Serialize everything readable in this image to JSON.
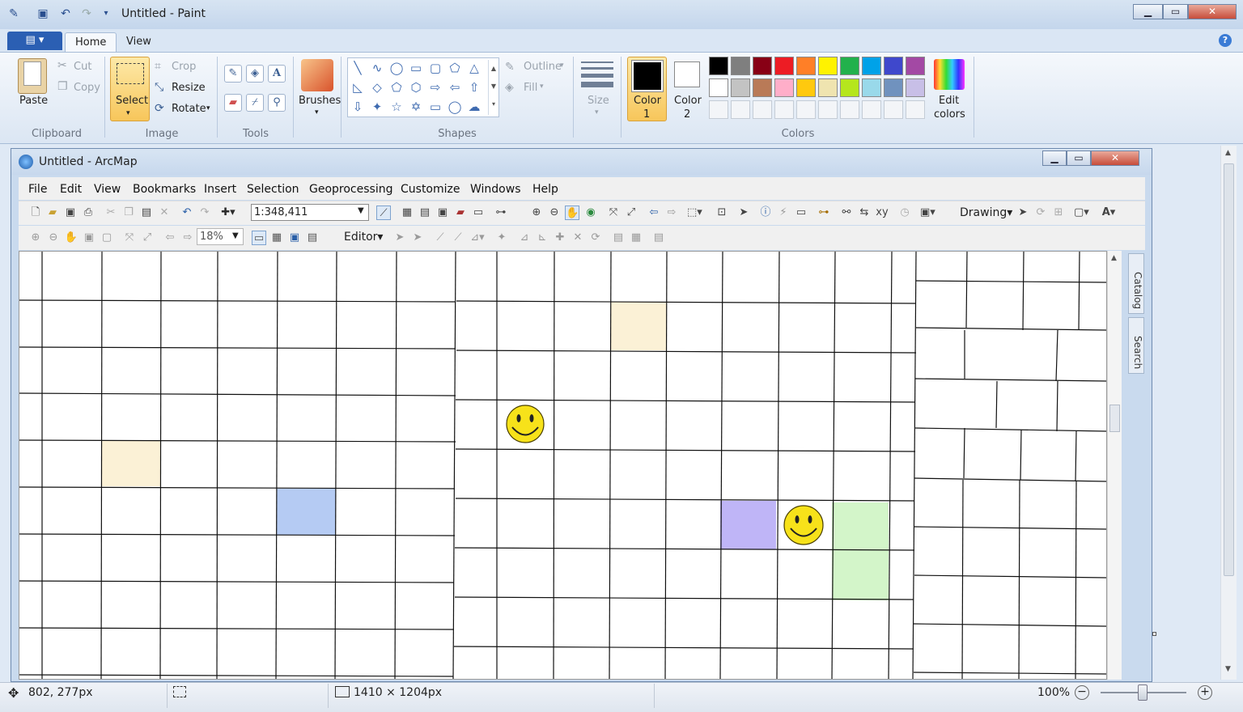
{
  "paint": {
    "title": "Untitled - Paint",
    "tabs": {
      "file_menu": "▤ ▾",
      "home": "Home",
      "view": "View"
    },
    "help": "?",
    "clipboard": {
      "paste": "Paste",
      "cut": "Cut",
      "copy": "Copy",
      "group": "Clipboard"
    },
    "image": {
      "select": "Select",
      "crop": "Crop",
      "resize": "Resize",
      "rotate": "Rotate",
      "group": "Image"
    },
    "tools": {
      "group": "Tools"
    },
    "brushes": {
      "label": "Brushes"
    },
    "shapes": {
      "outline": "Outline",
      "fill": "Fill",
      "group": "Shapes"
    },
    "size": {
      "label": "Size"
    },
    "colors": {
      "color1": "Color",
      "color1_num": "1",
      "color2": "Color",
      "color2_num": "2",
      "edit": "Edit",
      "edit2": "colors",
      "group": "Colors",
      "row1": [
        "#000000",
        "#7f7f7f",
        "#880015",
        "#ed1c24",
        "#ff7f27",
        "#fff200",
        "#22b14c",
        "#00a2e8",
        "#3f48cc",
        "#a349a4"
      ],
      "row2": [
        "#ffffff",
        "#c3c3c3",
        "#b97a57",
        "#ffaec9",
        "#ffc90e",
        "#efe4b0",
        "#b5e61d",
        "#99d9ea",
        "#7092be",
        "#c8bfe7"
      ]
    },
    "status": {
      "cursor": "802, 277px",
      "size": "1410 × 1204px",
      "zoom": "100%"
    }
  },
  "arcmap": {
    "title": "Untitled - ArcMap",
    "menus": [
      "File",
      "Edit",
      "View",
      "Bookmarks",
      "Insert",
      "Selection",
      "Geoprocessing",
      "Customize",
      "Windows",
      "Help"
    ],
    "scale": "1:348,411",
    "zoom": "18%",
    "editor": "Editor▾",
    "drawing": "Drawing▾",
    "side_tabs": {
      "catalog": "Catalog",
      "search": "Search"
    },
    "map_cells": [
      {
        "color": "#fbf1d6"
      },
      {
        "color": "#fbf1d6"
      },
      {
        "color": "#b5cbf3"
      },
      {
        "color": "#bfb5f7"
      },
      {
        "color": "#d3f5c9"
      }
    ]
  }
}
